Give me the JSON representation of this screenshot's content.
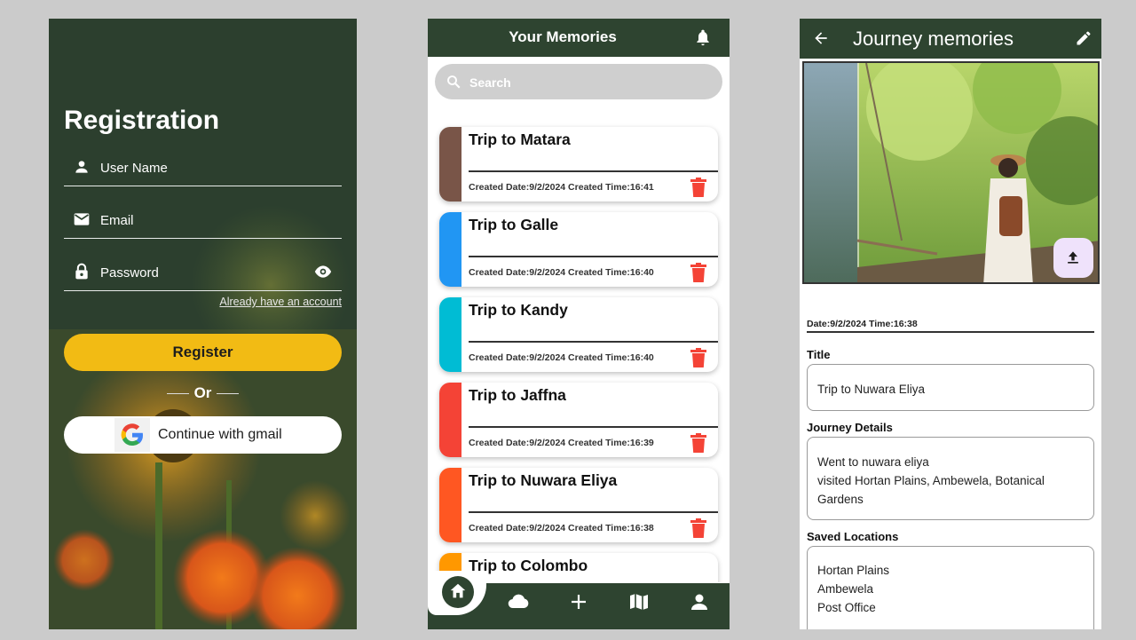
{
  "registration": {
    "title": "Registration",
    "fields": {
      "username": {
        "placeholder": "User Name",
        "icon": "person-icon"
      },
      "email": {
        "placeholder": "Email",
        "icon": "mail-icon"
      },
      "password": {
        "placeholder": "Password",
        "icon": "lock-icon",
        "trailing_icon": "eye-icon"
      }
    },
    "already_link": "Already have an account",
    "register_label": "Register",
    "or_text": "Or",
    "gmail_label": "Continue with gmail",
    "colors": {
      "accent": "#f2bb14",
      "background": "#2e4430"
    }
  },
  "memories": {
    "header_title": "Your Memories",
    "search_placeholder": "Search",
    "cards": [
      {
        "title": "Trip to Matara",
        "meta": "Created Date:9/2/2024 Created Time:16:41",
        "color": "#795548"
      },
      {
        "title": "Trip to Galle",
        "meta": "Created Date:9/2/2024 Created Time:16:40",
        "color": "#2196f3"
      },
      {
        "title": "Trip to Kandy",
        "meta": "Created Date:9/2/2024 Created Time:16:40",
        "color": "#00bcd4"
      },
      {
        "title": "Trip to Jaffna",
        "meta": "Created Date:9/2/2024 Created Time:16:39",
        "color": "#f44336"
      },
      {
        "title": "Trip to Nuwara Eliya",
        "meta": "Created Date:9/2/2024 Created Time:16:38",
        "color": "#ff5722"
      },
      {
        "title": "Trip to Colombo",
        "meta": "",
        "color": "#ff9800"
      }
    ],
    "nav_icons": [
      "home-icon",
      "cloud-icon",
      "add-icon",
      "map-icon",
      "person-icon"
    ]
  },
  "journey": {
    "header_title": "Journey memories",
    "date_line": "Date:9/2/2024  Time:16:38",
    "title_label": "Title",
    "title_value": "Trip to Nuwara Eliya",
    "details_label": "Journey Details",
    "details_lines": [
      "Went to nuwara eliya",
      "visited Hortan Plains, Ambewela, Botanical",
      "Gardens"
    ],
    "locations_label": "Saved Locations",
    "locations": [
      "Hortan Plains",
      "Ambewela",
      "Post Office"
    ]
  }
}
